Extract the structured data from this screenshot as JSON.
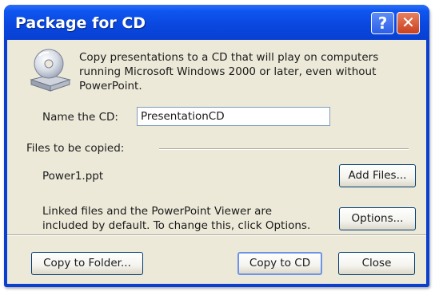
{
  "window": {
    "title": "Package for CD",
    "help_button": "?",
    "close_button": "✕"
  },
  "description": {
    "line1": "Copy presentations to a CD that will play on computers",
    "line2": "running Microsoft Windows 2000 or later, even without",
    "line3": "PowerPoint."
  },
  "name_field": {
    "label": "Name the CD:",
    "value": "PresentationCD"
  },
  "files": {
    "label": "Files to be copied:",
    "items": [
      "Power1.ppt"
    ]
  },
  "linked_note": {
    "line1": "Linked files and the PowerPoint Viewer are",
    "line2": "included by default. To change this, click Options."
  },
  "buttons": {
    "add_files": "Add Files...",
    "options": "Options...",
    "copy_to_folder": "Copy to Folder...",
    "copy_to_cd": "Copy to CD",
    "close": "Close"
  },
  "icons": {
    "cd": "cd-computer-icon"
  },
  "colors": {
    "titlebar": "#0a48e0",
    "client": "#ece9d8",
    "close_button": "#c8411f",
    "default_button_border": "#6d93e8"
  }
}
